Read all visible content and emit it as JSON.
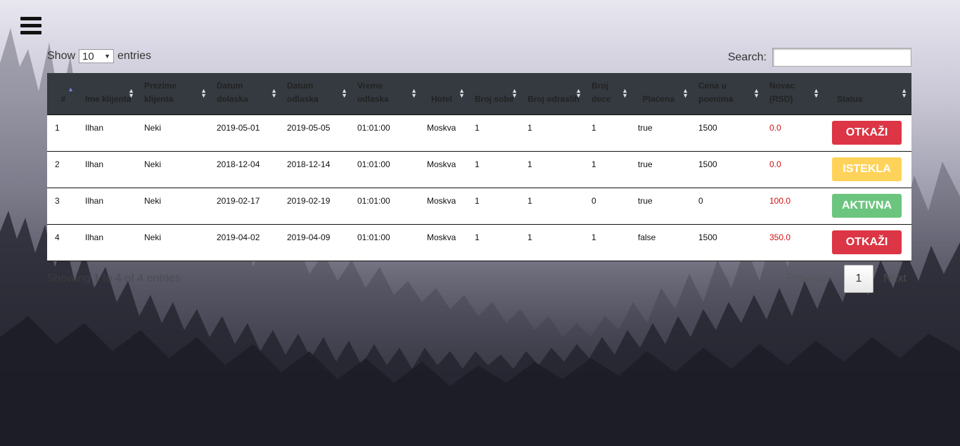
{
  "controls": {
    "show_label": "Show",
    "length_value": "10",
    "entries_label": "entries",
    "search_label": "Search:",
    "search_value": ""
  },
  "table": {
    "columns": [
      "#",
      "Ime klijenta",
      "Prezime klijenta",
      "Datum dolaska",
      "Datum odlaska",
      "Vreme odlaska",
      "Hotel",
      "Broj sobe",
      "Broj odraslih",
      "Broj dece",
      "Plaćena",
      "Cena u poenima",
      "Novac (RSD)",
      "Status"
    ],
    "rows": [
      {
        "id": "1",
        "ime": "Ilhan",
        "prezime": "Neki",
        "dolazak": "2019-05-01",
        "odlazak": "2019-05-05",
        "vreme": "01:01:00",
        "hotel": "Moskva",
        "soba": "1",
        "odrasli": "1",
        "deca": "1",
        "placena": "true",
        "poeni": "1500",
        "novac": "0.0",
        "status": "OTKAŽI"
      },
      {
        "id": "2",
        "ime": "Ilhan",
        "prezime": "Neki",
        "dolazak": "2018-12-04",
        "odlazak": "2018-12-14",
        "vreme": "01:01:00",
        "hotel": "Moskva",
        "soba": "1",
        "odrasli": "1",
        "deca": "1",
        "placena": "true",
        "poeni": "1500",
        "novac": "0.0",
        "status": "ISTEKLA"
      },
      {
        "id": "3",
        "ime": "Ilhan",
        "prezime": "Neki",
        "dolazak": "2019-02-17",
        "odlazak": "2019-02-19",
        "vreme": "01:01:00",
        "hotel": "Moskva",
        "soba": "1",
        "odrasli": "1",
        "deca": "0",
        "placena": "true",
        "poeni": "0",
        "novac": "100.0",
        "status": "AKTIVNA"
      },
      {
        "id": "4",
        "ime": "Ilhan",
        "prezime": "Neki",
        "dolazak": "2019-04-02",
        "odlazak": "2019-04-09",
        "vreme": "01:01:00",
        "hotel": "Moskva",
        "soba": "1",
        "odrasli": "1",
        "deca": "1",
        "placena": "false",
        "poeni": "1500",
        "novac": "350.0",
        "status": "OTKAŽI"
      }
    ]
  },
  "footer": {
    "info": "Showing 1 to 4 of 4 entries",
    "previous": "Previous",
    "page": "1",
    "next": "Next"
  },
  "colors": {
    "cancel": "#dc3545",
    "expired": "#ffd25a",
    "active": "#6cc57f",
    "header_bg": "#343a40",
    "money": "#d01010"
  },
  "icons": {
    "menu": "hamburger-icon",
    "sort": "sort-both-icon",
    "sort_asc": "sort-asc-icon"
  }
}
